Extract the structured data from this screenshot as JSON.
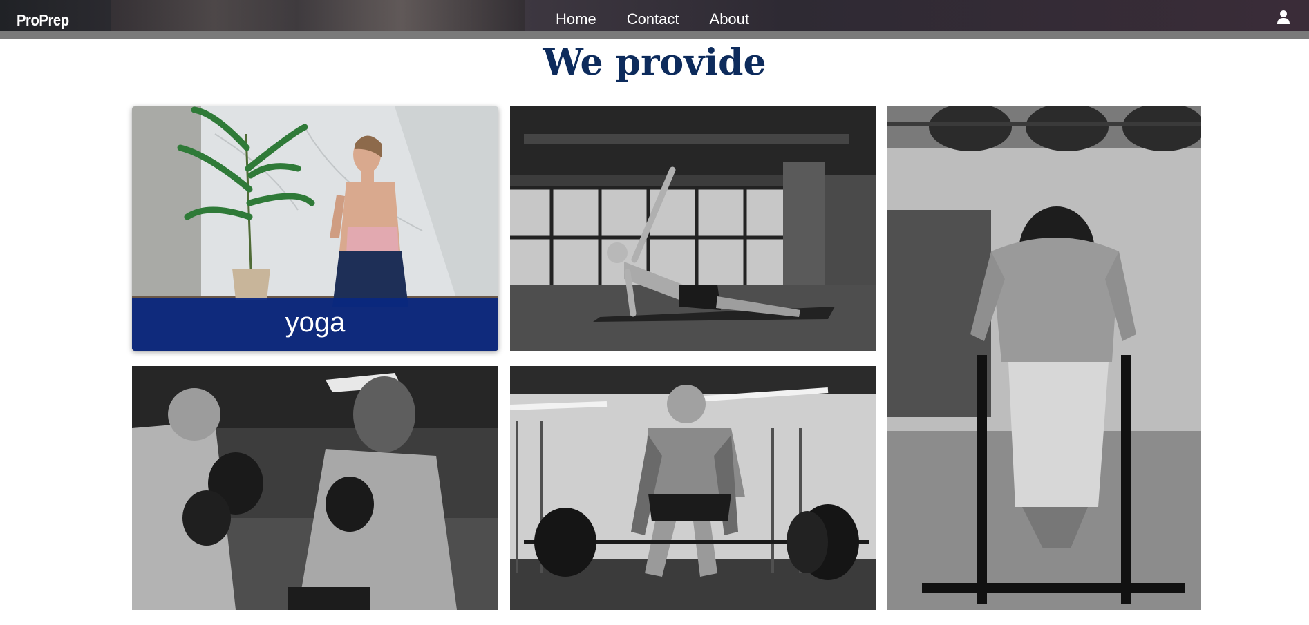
{
  "header": {
    "logo": "ProPrep",
    "nav": [
      {
        "label": "Home"
      },
      {
        "label": "Contact"
      },
      {
        "label": "About"
      }
    ],
    "user_icon": "user-icon"
  },
  "main": {
    "title": "We provide",
    "cards": [
      {
        "id": "yoga",
        "caption": "yoga",
        "image": "woman-meditating-photo"
      },
      {
        "id": "plank",
        "caption": "",
        "image": "side-plank-photo"
      },
      {
        "id": "dips",
        "caption": "",
        "image": "parallel-bar-dips-photo"
      },
      {
        "id": "boxing",
        "caption": "",
        "image": "boxing-sparring-photo"
      },
      {
        "id": "deadlift",
        "caption": "",
        "image": "barbell-deadlift-photo"
      }
    ]
  },
  "colors": {
    "title": "#0d2b5c",
    "caption_bg": "#0a2880",
    "nav_bg": "#2f2a33",
    "nav_underline": "#7a7a7a"
  }
}
